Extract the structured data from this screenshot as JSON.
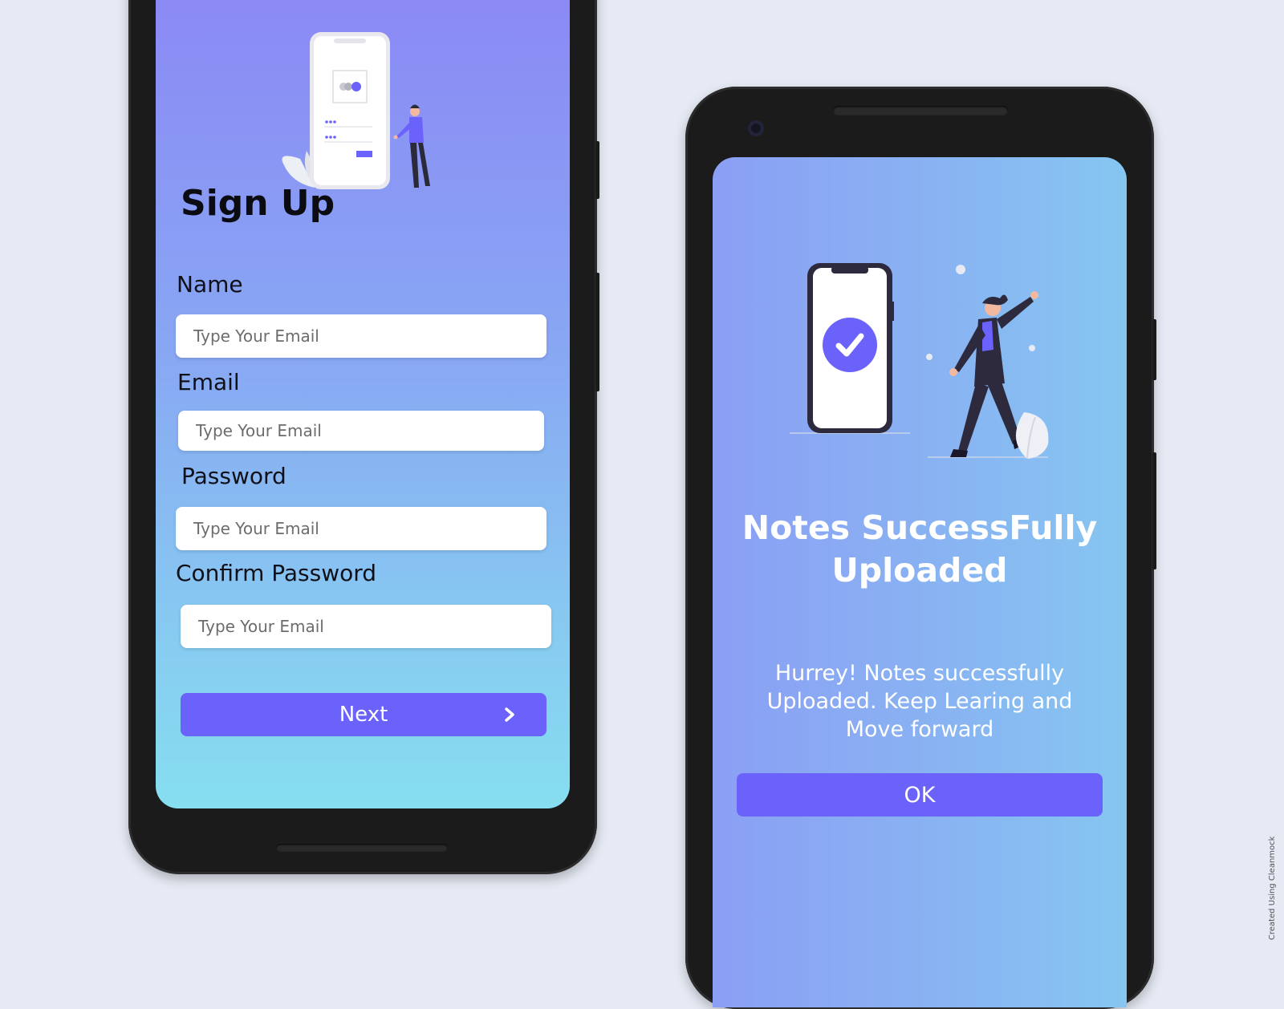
{
  "signup": {
    "title": "Sign Up",
    "fields": [
      {
        "label": "Name",
        "placeholder": "Type Your Email"
      },
      {
        "label": "Email",
        "placeholder": "Type Your Email"
      },
      {
        "label": "Password",
        "placeholder": "Type Your Email"
      },
      {
        "label": "Confirm Password",
        "placeholder": "Type Your Email"
      }
    ],
    "next_label": "Next",
    "next_icon": "chevron-right-icon"
  },
  "success": {
    "title_line1": "Notes SuccessFully",
    "title_line2": "Uploaded",
    "message_line1": "Hurrey! Notes successfully",
    "message_line2": "Uploaded. Keep Learing and",
    "message_line3": "Move forward",
    "ok_label": "OK",
    "status_icon": "check-circle-icon"
  },
  "credit": "Created Using Cleanmock",
  "colors": {
    "background": "#e6eaf4",
    "accent": "#6a62fb",
    "phone_frame": "#1b1b1b"
  }
}
